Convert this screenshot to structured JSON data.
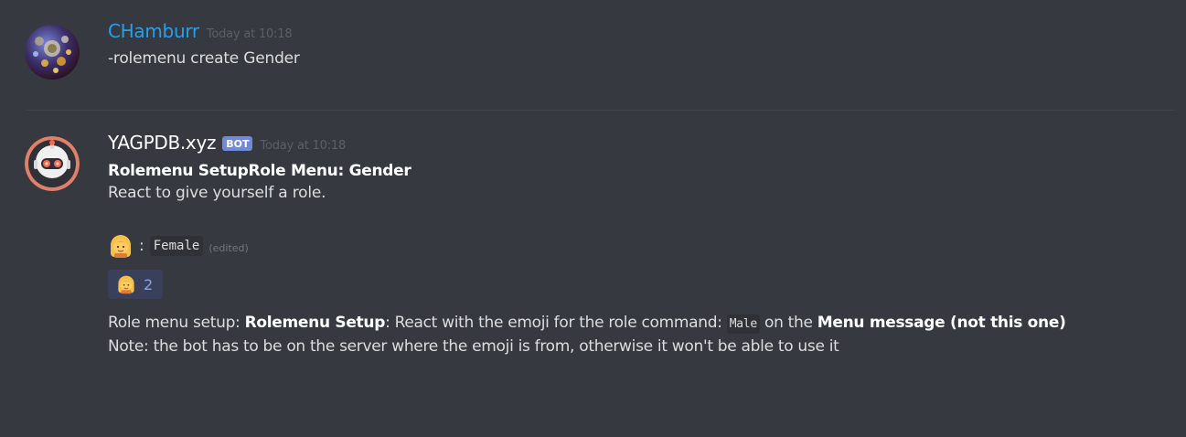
{
  "messages": [
    {
      "username": "CHamburr",
      "timestamp": "Today at 10:18",
      "text": "-rolemenu create Gender",
      "username_color": "#2a9ee8"
    },
    {
      "username": "YAGPDB.xyz",
      "badge": "BOT",
      "timestamp": "Today at 10:18",
      "embed_title": "Rolemenu SetupRole Menu: Gender",
      "description": "React to give yourself a role.",
      "option": {
        "emoji": "woman-emoji",
        "separator": ":",
        "role": "Female",
        "edited_label": "(edited)"
      },
      "reaction": {
        "emoji": "woman-emoji",
        "count": "2"
      },
      "setup": {
        "prefix": "Role menu setup: ",
        "bold1": "Rolemenu Setup",
        "mid1": ": React with the emoji for the role command: ",
        "code": "Male",
        "mid2": " on the ",
        "bold2": "Menu message (not this one)",
        "note": "Note: the bot has to be on the server where the emoji is from, otherwise it won't be able to use it"
      }
    }
  ],
  "colors": {
    "background": "#36393f",
    "bot_badge": "#7289da",
    "reaction_bg": "#3b405a",
    "reaction_count": "#8ea1e1"
  }
}
